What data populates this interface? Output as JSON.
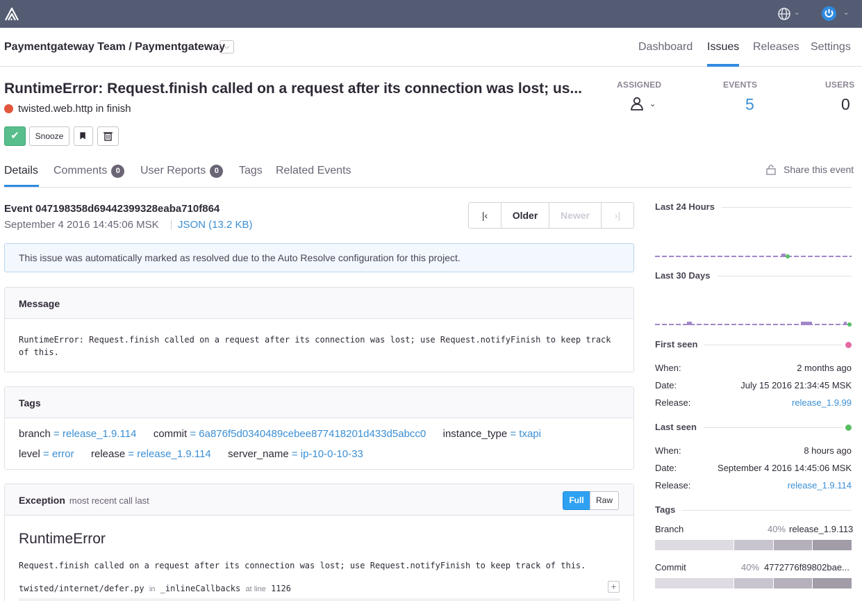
{
  "topbar": {
    "logo_icon": "sentry-logo-icon",
    "language_icon": "globe-icon",
    "user_icon": "power-icon",
    "accent": "#545c73"
  },
  "header": {
    "project": "Paymentgateway Team / Paymentgateway",
    "nav": [
      "Dashboard",
      "Issues",
      "Releases",
      "Settings"
    ],
    "active_nav": "Issues"
  },
  "issue": {
    "title": "RuntimeError: Request.finish called on a request after its connection was lost; us...",
    "culprit": "twisted.web.http in finish",
    "level_color": "#e2563b",
    "actions": {
      "resolve_icon": "check-icon",
      "snooze": "Snooze",
      "bookmark_icon": "bookmark-icon",
      "delete_icon": "trash-icon"
    },
    "stats": {
      "assigned_label": "ASSIGNED",
      "events_label": "EVENTS",
      "events_value": "5",
      "users_label": "USERS",
      "users_value": "0"
    }
  },
  "tabs": {
    "details": "Details",
    "comments": "Comments",
    "comments_count": "0",
    "user_reports": "User Reports",
    "user_reports_count": "0",
    "tags": "Tags",
    "related": "Related Events",
    "share": "Share this event"
  },
  "event": {
    "id_line": "Event 047198358d69442399328eaba710f864",
    "date": "September 4 2016 14:45:06 MSK",
    "json_link": "JSON (13.2 KB)",
    "pager": {
      "older": "Older",
      "newer": "Newer"
    }
  },
  "alert": "This issue was automatically marked as resolved due to the Auto Resolve configuration for this project.",
  "message": {
    "title": "Message",
    "text": "RuntimeError: Request.finish called on a request after its connection was lost; use Request.notifyFinish to keep track of this."
  },
  "tags_box": {
    "title": "Tags",
    "row1": [
      {
        "k": "branch",
        "v": "release_1.9.114"
      },
      {
        "k": "commit",
        "v": "6a876f5d0340489cebee877418201d433d5abcc0"
      },
      {
        "k": "instance_type",
        "v": "txapi"
      }
    ],
    "row2": [
      {
        "k": "level",
        "v": "error"
      },
      {
        "k": "release",
        "v": "release_1.9.114"
      },
      {
        "k": "server_name",
        "v": "ip-10-0-10-33"
      }
    ],
    "eq": "="
  },
  "exception": {
    "title": "Exception",
    "subtitle": "most recent call last",
    "full": "Full",
    "raw": "Raw",
    "type": "RuntimeError",
    "value": "Request.finish called on a request after its connection was lost; use Request.notifyFinish to keep track of this.",
    "frame_file": "twisted/internet/defer.py",
    "frame_in": "in",
    "frame_func": "_inlineCallbacks",
    "frame_at": "at line",
    "frame_line": "1126",
    "expand": "+"
  },
  "sidebar": {
    "last24": "Last 24 Hours",
    "last30": "Last 30 Days",
    "spark_color": "#a087c8",
    "first_seen": {
      "title": "First seen",
      "dot_color": "#e36aa3",
      "when_label": "When:",
      "when": "2 months ago",
      "date_label": "Date:",
      "date": "July 15 2016 21:34:45 MSK",
      "release_label": "Release:",
      "release": "release_1.9.99"
    },
    "last_seen": {
      "title": "Last seen",
      "dot_color": "#57be62",
      "when_label": "When:",
      "when": "8 hours ago",
      "date_label": "Date:",
      "date": "September 4 2016 14:45:06 MSK",
      "release_label": "Release:",
      "release": "release_1.9.114"
    },
    "tags_title": "Tags",
    "tag_dists": [
      {
        "name": "Branch",
        "pct": "40%",
        "top": "release_1.9.113",
        "fractions": [
          0.4,
          0.2,
          0.2,
          0.2
        ]
      },
      {
        "name": "Commit",
        "pct": "40%",
        "top": "4772776f89802bae...",
        "fractions": [
          0.4,
          0.2,
          0.2,
          0.2
        ]
      }
    ]
  }
}
